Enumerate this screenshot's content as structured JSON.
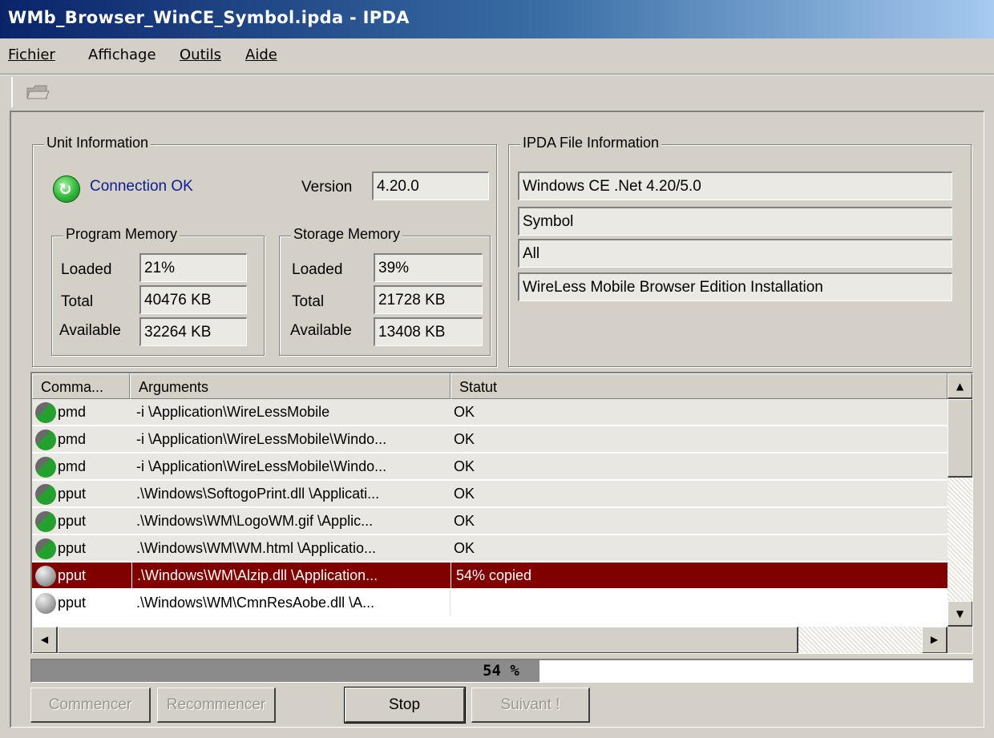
{
  "window": {
    "title": "WMb_Browser_WinCE_Symbol.ipda - IPDA"
  },
  "menu": [
    {
      "label": "Fichier"
    },
    {
      "label": "Affichage"
    },
    {
      "label": "Outils"
    },
    {
      "label": "Aide"
    }
  ],
  "toolbar": {
    "open_icon": "open-folder-icon"
  },
  "unit_info": {
    "title": "Unit Information",
    "connection": "Connection OK",
    "version_label": "Version",
    "version": "4.20.0",
    "program_memory": {
      "title": "Program Memory",
      "loaded_label": "Loaded",
      "loaded": "21%",
      "total_label": "Total",
      "total": "40476 KB",
      "available_label": "Available",
      "available": "32264 KB"
    },
    "storage_memory": {
      "title": "Storage Memory",
      "loaded_label": "Loaded",
      "loaded": "39%",
      "total_label": "Total",
      "total": "21728 KB",
      "available_label": "Available",
      "available": "13408 KB"
    }
  },
  "ipda_info": {
    "title": "IPDA File Information",
    "fields": [
      "Windows CE .Net 4.20/5.0",
      "Symbol",
      "All",
      "WireLess Mobile Browser Edition Installation"
    ]
  },
  "list": {
    "headers": [
      "Comma...",
      "Arguments",
      "Statut"
    ],
    "rows": [
      {
        "command": "pmd",
        "arguments": "-i  \\Application\\WireLessMobile",
        "status": "OK",
        "state": "done"
      },
      {
        "command": "pmd",
        "arguments": "-i  \\Application\\WireLessMobile\\Windo...",
        "status": "OK",
        "state": "done"
      },
      {
        "command": "pmd",
        "arguments": "-i  \\Application\\WireLessMobile\\Windo...",
        "status": "OK",
        "state": "done"
      },
      {
        "command": "pput",
        "arguments": "  .\\Windows\\SoftogoPrint.dll  \\Applicati...",
        "status": "OK",
        "state": "done"
      },
      {
        "command": "pput",
        "arguments": "  .\\Windows\\WM\\LogoWM.gif  \\Applic...",
        "status": "OK",
        "state": "done"
      },
      {
        "command": "pput",
        "arguments": "  .\\Windows\\WM\\WM.html  \\Applicatio...",
        "status": "OK",
        "state": "done"
      },
      {
        "command": "pput",
        "arguments": "  .\\Windows\\WM\\Alzip.dll  \\Application...",
        "status": "54% copied",
        "state": "active"
      },
      {
        "command": "pput",
        "arguments": "  .\\Windows\\WM\\CmnResAobe.dll  \\A...",
        "status": "",
        "state": "pending"
      }
    ]
  },
  "progress": {
    "value": 0.54,
    "text": "54 %"
  },
  "buttons": {
    "start": "Commencer",
    "restart": "Recommencer",
    "stop": "Stop",
    "next": "Suivant !"
  }
}
